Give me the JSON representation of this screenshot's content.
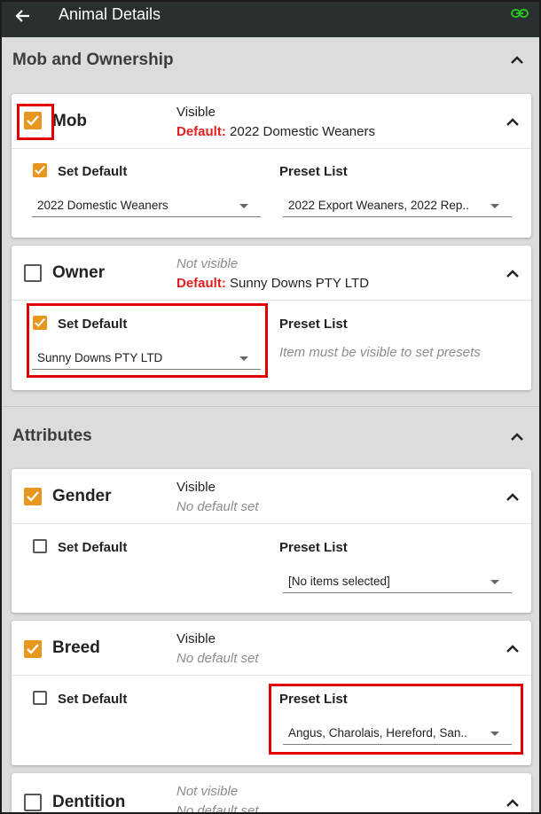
{
  "header": {
    "back_icon": "back-arrow-icon",
    "title": "Animal Details",
    "link_icon": "link-icon",
    "link_color": "#26c21e"
  },
  "colors": {
    "checkbox_on": "#e8971e",
    "default_label": "#e02020",
    "highlight": "#e00000"
  },
  "sections": {
    "mob_ownership": {
      "title": "Mob and Ownership",
      "mob": {
        "name": "Mob",
        "visibility": "Visible",
        "default_label": "Default:",
        "default_value": "2022 Domestic Weaners",
        "set_default_label": "Set Default",
        "set_default_dropdown": "2022 Domestic Weaners",
        "preset_label": "Preset List",
        "preset_dropdown": "2022 Export Weaners, 2022 Rep.."
      },
      "owner": {
        "name": "Owner",
        "visibility": "Not visible",
        "default_label": "Default:",
        "default_value": "Sunny Downs PTY LTD",
        "set_default_label": "Set Default",
        "set_default_dropdown": "Sunny Downs PTY LTD",
        "preset_label": "Preset List",
        "preset_hint": "Item must be visible to set presets"
      }
    },
    "attributes": {
      "title": "Attributes",
      "gender": {
        "name": "Gender",
        "visibility": "Visible",
        "default_text": "No default set",
        "set_default_label": "Set Default",
        "preset_label": "Preset List",
        "preset_dropdown": "[No items selected]"
      },
      "breed": {
        "name": "Breed",
        "visibility": "Visible",
        "default_text": "No default set",
        "set_default_label": "Set Default",
        "preset_label": "Preset List",
        "preset_dropdown": "Angus, Charolais, Hereford, San.."
      },
      "dentition": {
        "name": "Dentition",
        "visibility": "Not visible",
        "default_text": "No default set"
      }
    }
  }
}
